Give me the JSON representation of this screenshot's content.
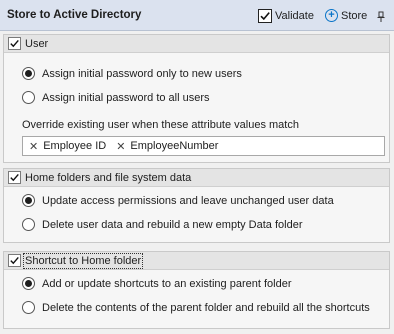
{
  "header": {
    "title": "Store to Active Directory",
    "validate_label": "Validate",
    "store_label": "Store"
  },
  "groups": [
    {
      "title": "User",
      "checked": true,
      "options": [
        {
          "label": "Assign initial password only to new users",
          "selected": true
        },
        {
          "label": "Assign initial password to all users",
          "selected": false
        }
      ],
      "override_label": "Override existing user when these attribute values match",
      "attributes": [
        "Employee ID",
        "EmployeeNumber"
      ]
    },
    {
      "title": "Home folders and file system data",
      "checked": true,
      "options": [
        {
          "label": "Update access permissions and leave unchanged user data",
          "selected": true
        },
        {
          "label": "Delete user data and rebuild a new empty Data folder",
          "selected": false
        }
      ]
    },
    {
      "title": "Shortcut to Home folder",
      "checked": true,
      "options": [
        {
          "label": "Add or update shortcuts to an existing parent folder",
          "selected": true
        },
        {
          "label": "Delete the contents of the parent folder and rebuild all the shortcuts",
          "selected": false
        }
      ]
    }
  ],
  "colors": {
    "header_bg": "#dbe2ef",
    "accent": "#0a74c8"
  }
}
